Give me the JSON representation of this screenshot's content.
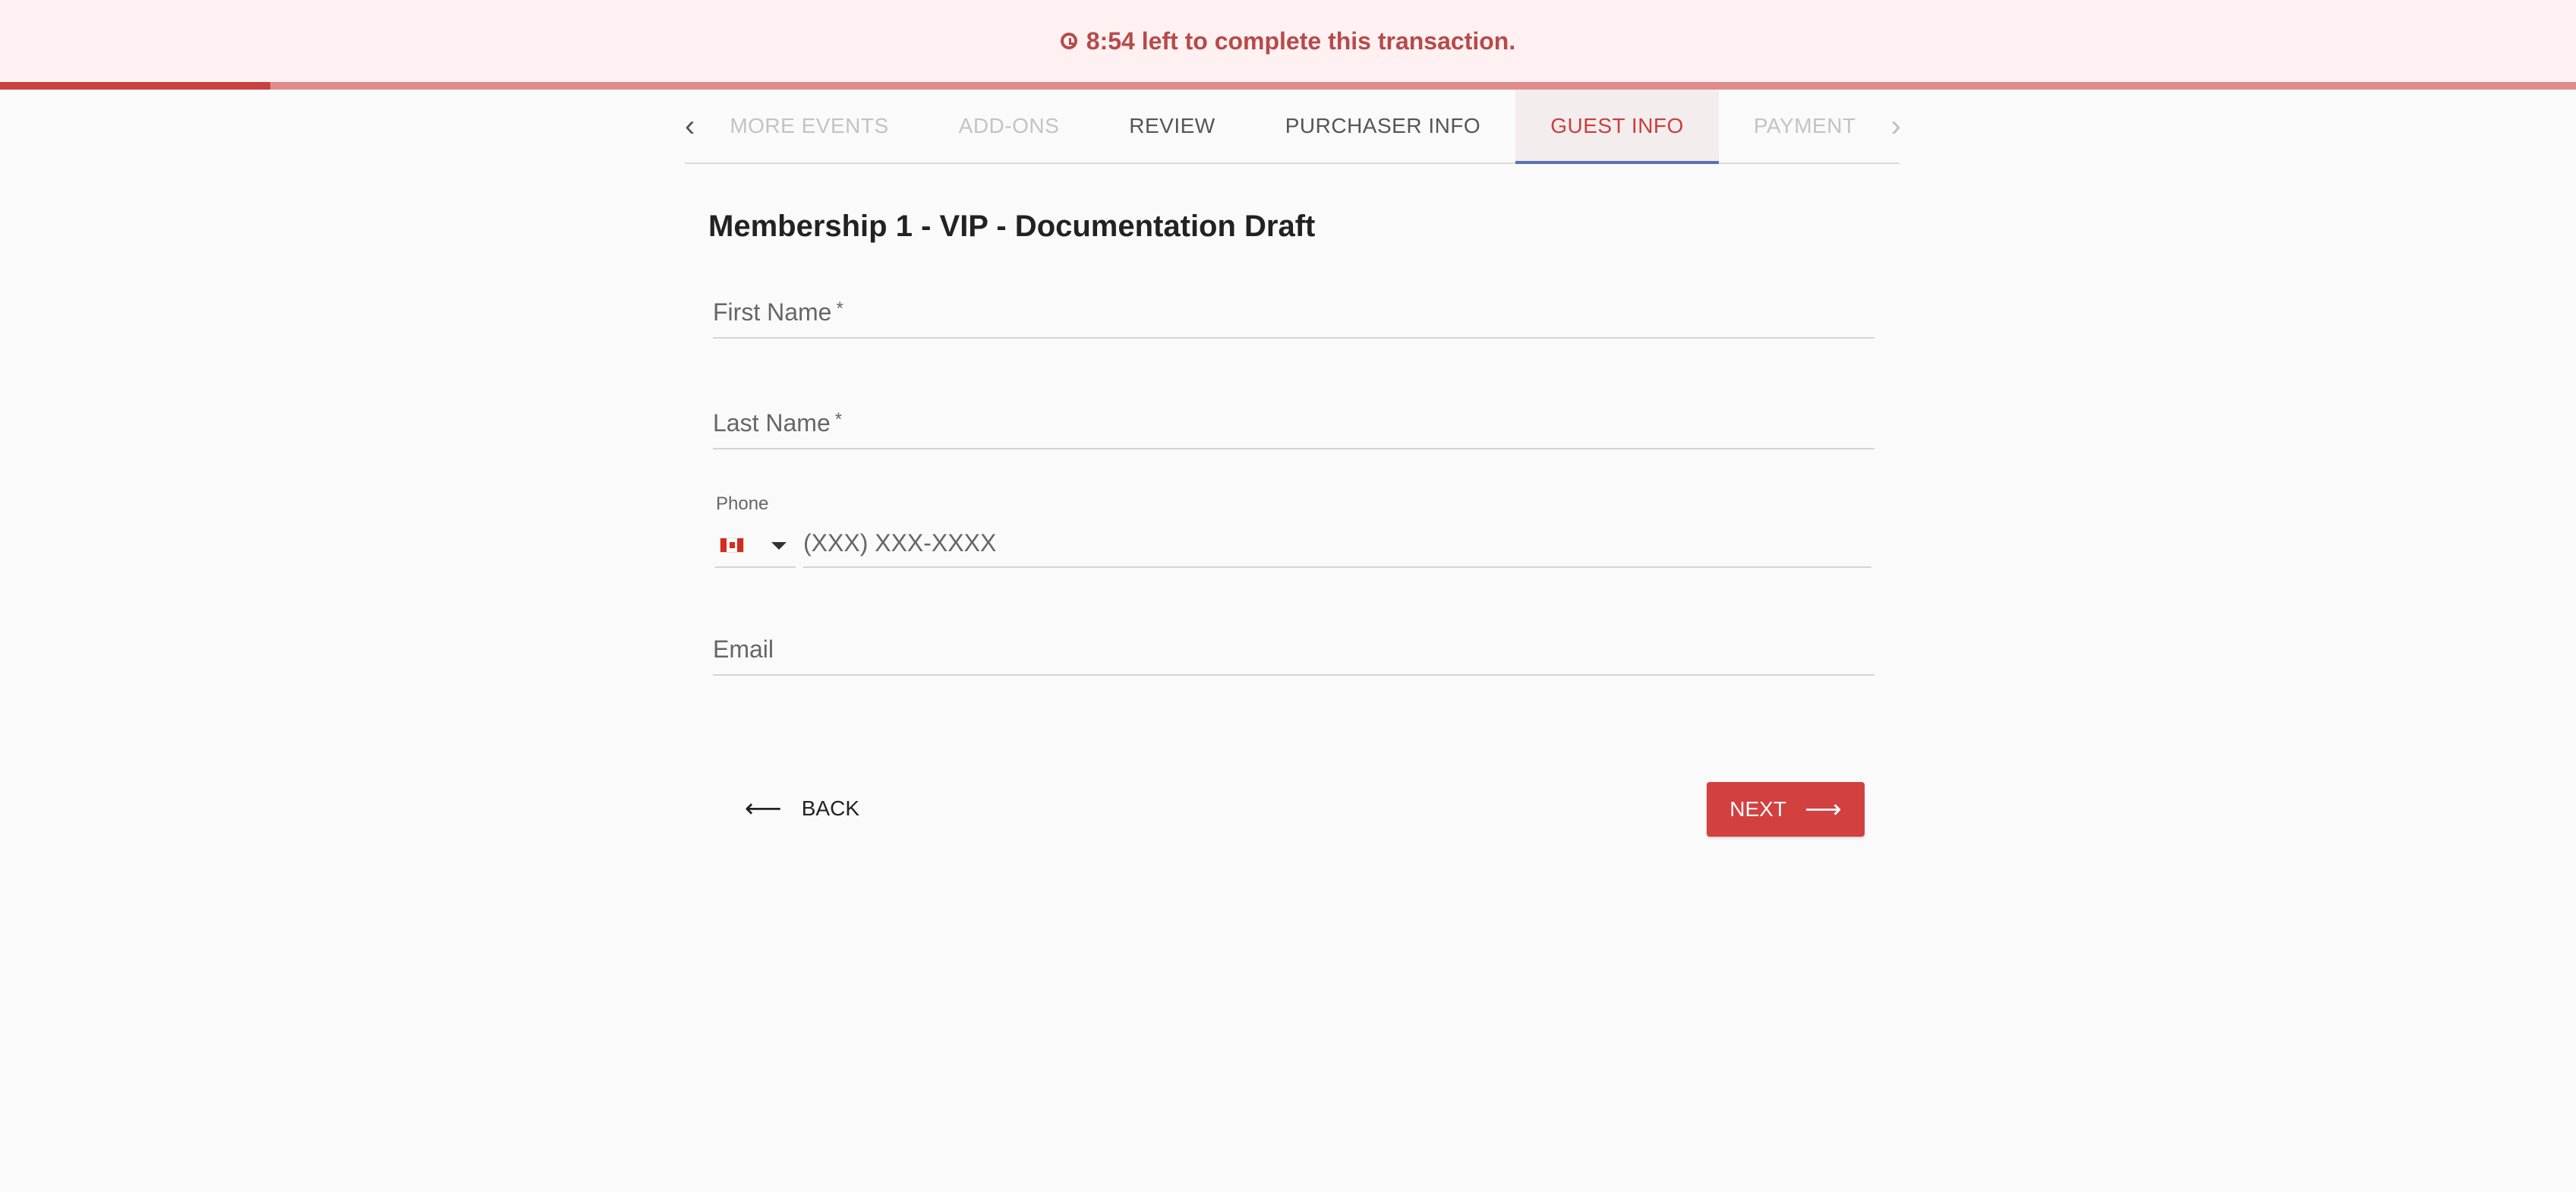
{
  "timer": {
    "text": "8:54 left to complete this transaction.",
    "progress": 0.105
  },
  "tabs": [
    {
      "label": "MORE EVENTS",
      "state": "disabled"
    },
    {
      "label": "ADD-ONS",
      "state": "disabled"
    },
    {
      "label": "REVIEW",
      "state": "normal"
    },
    {
      "label": "PURCHASER INFO",
      "state": "normal"
    },
    {
      "label": "GUEST INFO",
      "state": "active"
    },
    {
      "label": "PAYMENT",
      "state": "disabled"
    }
  ],
  "nav_icons": {
    "prev": "‹",
    "next": "›"
  },
  "form": {
    "title": "Membership 1 - VIP - Documentation Draft",
    "first_name_label": "First Name",
    "last_name_label": "Last Name",
    "required_mark": "*",
    "phone_label": "Phone",
    "phone_placeholder": "(XXX) XXX-XXXX",
    "email_label": "Email",
    "country_flag": "canada-flag"
  },
  "actions": {
    "back_label": "BACK",
    "back_arrow": "⟵",
    "next_label": "NEXT",
    "next_arrow": "⟶"
  },
  "colors": {
    "accent": "#d24040",
    "tab_indicator": "#5b6fb5",
    "timer_text": "#b74a4a"
  }
}
